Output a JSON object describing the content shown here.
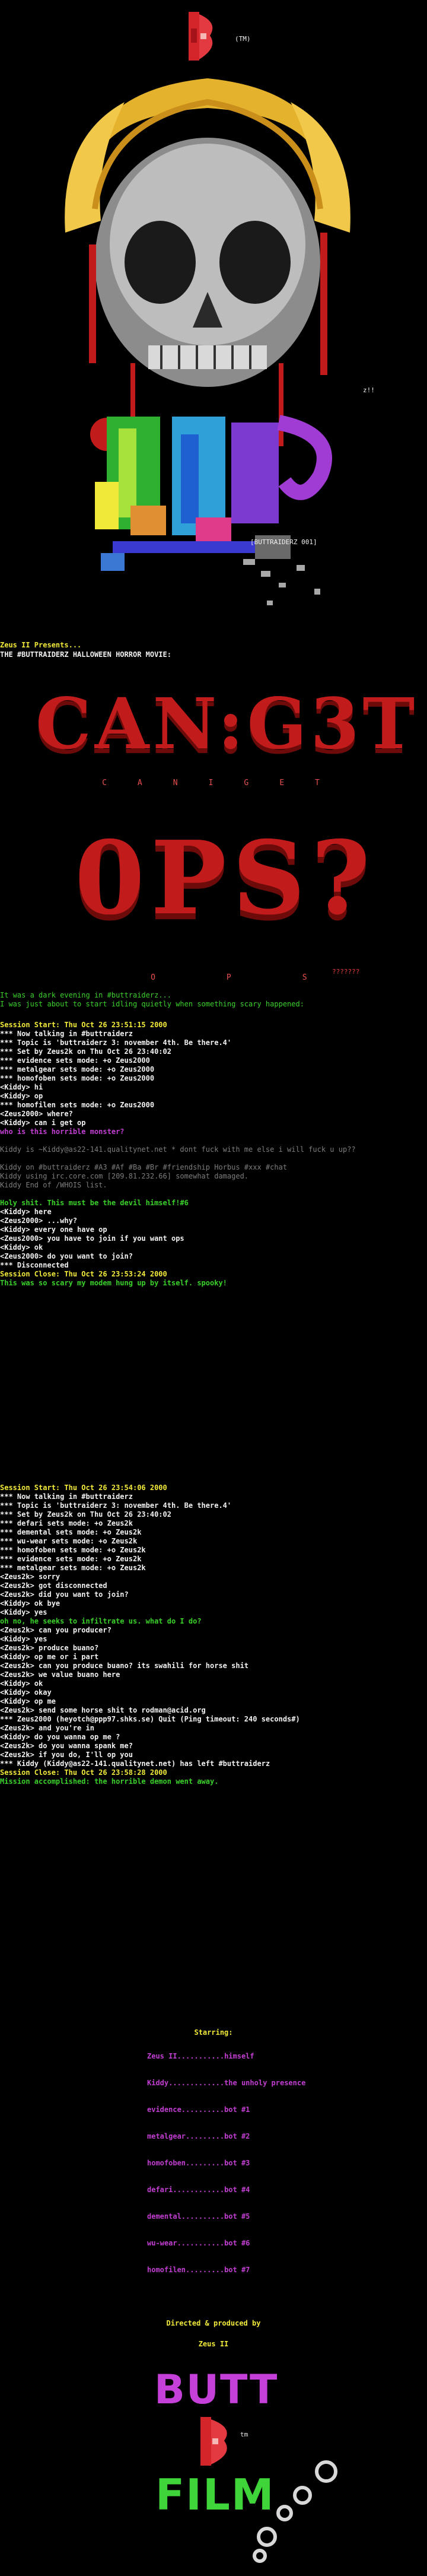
{
  "logo_top": {
    "tm": "(TM)"
  },
  "art_signature": "z!!",
  "art_tag": "[BUTTRAIDERZ 001]",
  "presents": "Zeus II Presents...",
  "movie_line": "THE #BUTTRAIDERZ HALLOWEEN HORROR MOVIE:",
  "title_big_1": "CAN:G3T",
  "title_letters_1": [
    "C",
    "A",
    "N",
    "I",
    "G",
    "E",
    "T"
  ],
  "title_big_2": "0PS?",
  "title_letters_2": [
    "O",
    "P",
    "S"
  ],
  "title_question": "???????",
  "intro": [
    "It was a dark evening in #buttraiderz...",
    "I was just about to start idling quietly when something scary happened:"
  ],
  "log1": [
    {
      "c": "y",
      "t": "Session Start: Thu Oct 26 23:51:15 2000"
    },
    {
      "c": "w",
      "t": "*** Now talking in #buttraiderz"
    },
    {
      "c": "w",
      "t": "*** Topic is 'buttraiderz 3: november 4th. Be there.4'"
    },
    {
      "c": "w",
      "t": "*** Set by Zeus2k on Thu Oct 26 23:40:02"
    },
    {
      "c": "w",
      "t": "*** evidence sets mode: +o Zeus2000"
    },
    {
      "c": "w",
      "t": "*** metalgear sets mode: +o Zeus2000"
    },
    {
      "c": "w",
      "t": "*** homofoben sets mode: +o Zeus2000"
    },
    {
      "c": "w",
      "t": "<Kiddy> hi"
    },
    {
      "c": "w",
      "t": "<Kiddy> op"
    },
    {
      "c": "w",
      "t": "*** homofilen sets mode: +o Zeus2000"
    },
    {
      "c": "w",
      "t": "<Zeus2000> where?"
    },
    {
      "c": "w",
      "t": "<Kiddy> can i get op"
    },
    {
      "c": "m",
      "t": "who is this horrible monster?"
    },
    {
      "c": "blank",
      "t": " "
    },
    {
      "c": "dim",
      "t": "Kiddy is ~Kiddy@as22-141.qualitynet.net * dont fuck with me else i will fuck u up??"
    },
    {
      "c": "blank",
      "t": " "
    },
    {
      "c": "dim",
      "t": "Kiddy on #buttraiderz #A3 #Af #Ba #Br #friendship Horbus #xxx #chat"
    },
    {
      "c": "dim",
      "t": "Kiddy using irc.core.com [209.81.232.66] somewhat damaged."
    },
    {
      "c": "dim",
      "t": "Kiddy End of /WHOIS list."
    },
    {
      "c": "blank",
      "t": " "
    },
    {
      "c": "g",
      "t": "Holy shit. This must be the devil himself!#6"
    },
    {
      "c": "w",
      "t": "<Kiddy> here"
    },
    {
      "c": "w",
      "t": "<Zeus2000> ...why?"
    },
    {
      "c": "w",
      "t": "<Kiddy> every one have op"
    },
    {
      "c": "w",
      "t": "<Zeus2000> you have to join if you want ops"
    },
    {
      "c": "w",
      "t": "<Kiddy> ok"
    },
    {
      "c": "w",
      "t": "<Zeus2000> do you want to join?"
    },
    {
      "c": "w",
      "t": "*** Disconnected"
    },
    {
      "c": "y",
      "t": "Session Close: Thu Oct 26 23:53:24 2000"
    },
    {
      "c": "g",
      "t": "This was so scary my modem hung up by itself. spooky!"
    }
  ],
  "log2": [
    {
      "c": "y",
      "t": "Session Start: Thu Oct 26 23:54:06 2000"
    },
    {
      "c": "w",
      "t": "*** Now talking in #buttraiderz"
    },
    {
      "c": "w",
      "t": "*** Topic is 'buttraiderz 3: november 4th. Be there.4'"
    },
    {
      "c": "w",
      "t": "*** Set by Zeus2k on Thu Oct 26 23:40:02"
    },
    {
      "c": "w",
      "t": "*** defari sets mode: +o Zeus2k"
    },
    {
      "c": "w",
      "t": "*** demental sets mode: +o Zeus2k"
    },
    {
      "c": "w",
      "t": "*** wu-wear sets mode: +o Zeus2k"
    },
    {
      "c": "w",
      "t": "*** homofoben sets mode: +o Zeus2k"
    },
    {
      "c": "w",
      "t": "*** evidence sets mode: +o Zeus2k"
    },
    {
      "c": "w",
      "t": "*** metalgear sets mode: +o Zeus2k"
    },
    {
      "c": "w",
      "t": "<Zeus2k> sorry"
    },
    {
      "c": "w",
      "t": "<Zeus2k> got disconnected"
    },
    {
      "c": "w",
      "t": "<Zeus2k> did you want to join?"
    },
    {
      "c": "w",
      "t": "<Kiddy> ok bye"
    },
    {
      "c": "w",
      "t": "<Kiddy> yes"
    },
    {
      "c": "g",
      "t": "oh no, he seeks to infiltrate us. what do I do?"
    },
    {
      "c": "w",
      "t": "<Zeus2k> can you producer?"
    },
    {
      "c": "w",
      "t": "<Kiddy> yes"
    },
    {
      "c": "w",
      "t": "<Zeus2k> produce buano?"
    },
    {
      "c": "w",
      "t": "<Kiddy> op me or i part"
    },
    {
      "c": "w",
      "t": "<Zeus2k> can you produce buano? its swahili for horse shit"
    },
    {
      "c": "w",
      "t": "<Zeus2k> we value buano here"
    },
    {
      "c": "w",
      "t": "<Kiddy> ok"
    },
    {
      "c": "w",
      "t": "<Kiddy> okay"
    },
    {
      "c": "w",
      "t": "<Kiddy> op me"
    },
    {
      "c": "w",
      "t": "<Zeus2k> send some horse shit to rodman@acid.org"
    },
    {
      "c": "w",
      "t": "*** Zeus2000 (heyotch@ppp97.shks.se) Quit (Ping timeout: 240 seconds#)"
    },
    {
      "c": "w",
      "t": "<Zeus2k> and you're in"
    },
    {
      "c": "w",
      "t": "<Kiddy> do you wanna op me ?"
    },
    {
      "c": "w",
      "t": "<Zeus2k> do you wanna spank me?"
    },
    {
      "c": "w",
      "t": "<Zeus2k> if you do, I'll op you"
    },
    {
      "c": "w",
      "t": "*** Kiddy (Kiddy@as22-141.qualitynet.net) has left #buttraiderz"
    },
    {
      "c": "y",
      "t": "Session Close: Thu Oct 26 23:58:28 2000"
    },
    {
      "c": "g",
      "t": "Mission accomplished: the horrible demon went away."
    }
  ],
  "credits": {
    "starring": "Starring:",
    "cast": [
      {
        "name": "Zeus II",
        "dots": "...........",
        "role": "himself"
      },
      {
        "name": "Kiddy",
        "dots": ".............",
        "role": "the unholy presence"
      },
      {
        "name": "evidence",
        "dots": "..........",
        "role": "bot #1"
      },
      {
        "name": "metalgear",
        "dots": ".........",
        "role": "bot #2"
      },
      {
        "name": "homofoben",
        "dots": ".........",
        "role": "bot #3"
      },
      {
        "name": "defari",
        "dots": "............",
        "role": "bot #4"
      },
      {
        "name": "demental",
        "dots": "..........",
        "role": "bot #5"
      },
      {
        "name": "wu-wear",
        "dots": "...........",
        "role": "bot #6"
      },
      {
        "name": "homofilen",
        "dots": ".........",
        "role": "bot #7"
      }
    ],
    "directed": "Directed & produced by",
    "director": "Zeus II"
  },
  "logo_bottom": {
    "word1": "BUTT",
    "word2": "FILM",
    "tm": "tm"
  },
  "colors": {
    "bg": "#000000",
    "blood": "#c21b1b",
    "green": "#3ad12a",
    "yellow": "#f1e93a",
    "magenta": "#c13ed1"
  }
}
